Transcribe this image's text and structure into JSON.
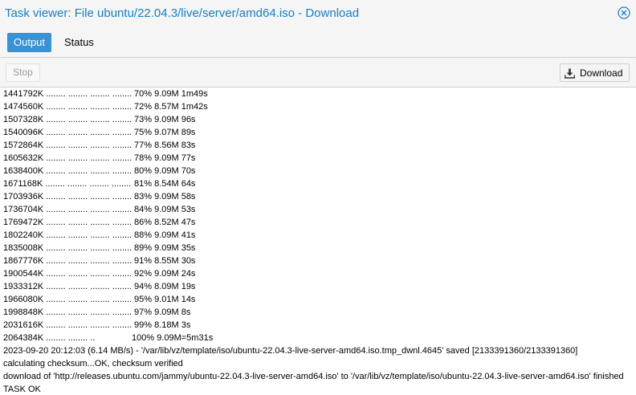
{
  "window": {
    "title": "Task viewer: File ubuntu/22.04.3/live/server/amd64.iso - Download",
    "close_icon": "close-circle-icon"
  },
  "tabs": [
    {
      "label": "Output",
      "active": true
    },
    {
      "label": "Status",
      "active": false
    }
  ],
  "toolbar": {
    "stop_label": "Stop",
    "stop_enabled": false,
    "download_label": "Download",
    "download_icon": "download-icon"
  },
  "log": {
    "progress_lines": [
      {
        "prefix": "1441792K ........ ........ ........ ........",
        "stat": "70% 9.09M 1m49s"
      },
      {
        "prefix": "1474560K ........ ........ ........ ........",
        "stat": "72% 8.57M 1m42s"
      },
      {
        "prefix": "1507328K ........ ........ ........ ........",
        "stat": "73% 9.09M 96s"
      },
      {
        "prefix": "1540096K ........ ........ ........ ........",
        "stat": "75% 9.07M 89s"
      },
      {
        "prefix": "1572864K ........ ........ ........ ........",
        "stat": "77% 8.56M 83s"
      },
      {
        "prefix": "1605632K ........ ........ ........ ........",
        "stat": "78% 9.09M 77s"
      },
      {
        "prefix": "1638400K ........ ........ ........ ........",
        "stat": "80% 9.09M 70s"
      },
      {
        "prefix": "1671168K ........ ........ ........ ........",
        "stat": "81% 8.54M 64s"
      },
      {
        "prefix": "1703936K ........ ........ ........ ........",
        "stat": "83% 9.09M 58s"
      },
      {
        "prefix": "1736704K ........ ........ ........ ........",
        "stat": "84% 9.09M 53s"
      },
      {
        "prefix": "1769472K ........ ........ ........ ........",
        "stat": "86% 8.52M 47s"
      },
      {
        "prefix": "1802240K ........ ........ ........ ........",
        "stat": "88% 9.09M 41s"
      },
      {
        "prefix": "1835008K ........ ........ ........ ........",
        "stat": "89% 9.09M 35s"
      },
      {
        "prefix": "1867776K ........ ........ ........ ........",
        "stat": "91% 8.55M 30s"
      },
      {
        "prefix": "1900544K ........ ........ ........ ........",
        "stat": "92% 9.09M 24s"
      },
      {
        "prefix": "1933312K ........ ........ ........ ........",
        "stat": "94% 8.09M 19s"
      },
      {
        "prefix": "1966080K ........ ........ ........ ........",
        "stat": "95% 9.01M 14s"
      },
      {
        "prefix": "1998848K ........ ........ ........ ........",
        "stat": "97% 9.09M 8s"
      },
      {
        "prefix": "2031616K ........ ........ ........ ........",
        "stat": "99% 8.18M 3s"
      },
      {
        "prefix": "2064384K ........ ........ ..",
        "stat": "100% 9.09M=5m31s"
      }
    ],
    "text_lines": [
      "2023-09-20 20:12:03 (6.14 MB/s) - '/var/lib/vz/template/iso/ubuntu-22.04.3-live-server-amd64.iso.tmp_dwnl.4645' saved [2133391360/2133391360]",
      "calculating checksum...OK, checksum verified",
      "download of 'http://releases.ubuntu.com/jammy/ubuntu-22.04.3-live-server-amd64.iso' to '/var/lib/vz/template/iso/ubuntu-22.04.3-live-server-amd64.iso' finished",
      "TASK OK"
    ]
  },
  "colors": {
    "title": "#157fcc",
    "active_tab": "#3892d4",
    "toolbar_bg": "#f5f5f5"
  }
}
